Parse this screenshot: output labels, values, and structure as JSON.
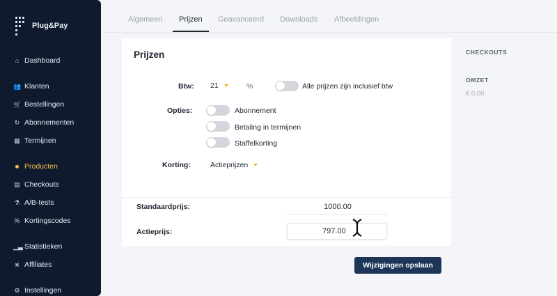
{
  "brand": {
    "name": "Plug&Pay"
  },
  "sidebar": {
    "items": [
      {
        "label": "Dashboard",
        "icon": "home-icon"
      },
      {
        "label": "Klanten",
        "icon": "users-icon"
      },
      {
        "label": "Bestellingen",
        "icon": "cart-icon"
      },
      {
        "label": "Abonnementen",
        "icon": "refresh-icon"
      },
      {
        "label": "Termijnen",
        "icon": "calendar-icon"
      },
      {
        "label": "Producten",
        "icon": "box-icon",
        "active": true
      },
      {
        "label": "Checkouts",
        "icon": "table-icon"
      },
      {
        "label": "A/B-tests",
        "icon": "flask-icon"
      },
      {
        "label": "Kortingscodes",
        "icon": "percent-icon"
      },
      {
        "label": "Statistieken",
        "icon": "chart-icon"
      },
      {
        "label": "Affiliates",
        "icon": "share-icon"
      },
      {
        "label": "Instellingen",
        "icon": "gear-icon"
      }
    ]
  },
  "tabs": [
    "Algemeen",
    "Prijzen",
    "Geavanceerd",
    "Downloads",
    "Afbeeldingen"
  ],
  "active_tab": "Prijzen",
  "section": {
    "title": "Prijzen",
    "btw_label": "Btw:",
    "btw_value": "21",
    "btw_unit": "%",
    "incl_btw_label": "Alle prijzen zijn inclusief btw",
    "opties_label": "Opties:",
    "options": [
      "Abonnement",
      "Betaling in termijnen",
      "Staffelkorting"
    ],
    "korting_label": "Korting:",
    "korting_value": "Actieprijzen",
    "standaard_label": "Standaardprijs:",
    "standaard_value": "1000.00",
    "actie_label": "Actieprijs:",
    "actie_value": "797.00"
  },
  "save_label": "Wijzigingen opslaan",
  "right_panel": {
    "checkouts_label": "CHECKOUTS",
    "omzet_label": "OMZET",
    "omzet_value": "€ 0,00"
  },
  "colors": {
    "sidebar": "#0f1a2e",
    "accent": "#f5c04a",
    "button": "#1d3557"
  }
}
